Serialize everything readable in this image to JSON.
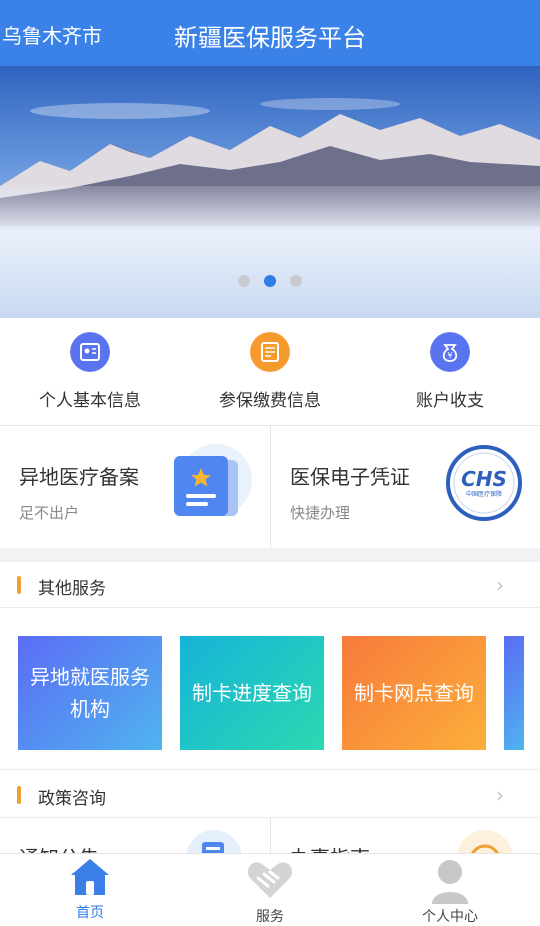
{
  "header": {
    "city": "乌鲁木齐市",
    "title": "新疆医保服务平台"
  },
  "banner": {
    "slide_count": 3,
    "active_slide": 2
  },
  "quick_actions": [
    {
      "label": "个人基本信息",
      "icon": "id-card-icon",
      "color": "#5a74f0"
    },
    {
      "label": "参保缴费信息",
      "icon": "payment-record-icon",
      "color": "#f59a2c"
    },
    {
      "label": "账户收支",
      "icon": "money-bag-icon",
      "color": "#5a74f0"
    }
  ],
  "cards": [
    {
      "title": "异地医疗备案",
      "subtitle": "足不出户",
      "icon": "star-document-icon"
    },
    {
      "title": "医保电子凭证",
      "subtitle": "快捷办理",
      "icon": "chs-logo-icon",
      "logo_text": "CHS",
      "logo_subtext": "中国医疗保障"
    }
  ],
  "sections": {
    "other_services": {
      "title": "其他服务",
      "arrow": "›"
    },
    "policy": {
      "title": "政策咨询",
      "arrow": "›"
    }
  },
  "service_tiles": [
    {
      "label": "异地就医服务机构"
    },
    {
      "label": "制卡进度查询"
    },
    {
      "label": "制卡网点查询"
    }
  ],
  "policy_cards": [
    {
      "title": "通知公告",
      "icon": "notice-icon"
    },
    {
      "title": "办事指南",
      "icon": "guide-icon"
    }
  ],
  "tabbar": [
    {
      "label": "首页",
      "icon": "home-icon",
      "active": true
    },
    {
      "label": "服务",
      "icon": "handshake-icon",
      "active": false
    },
    {
      "label": "个人中心",
      "icon": "user-icon",
      "active": false
    }
  ],
  "colors": {
    "primary": "#3b82e8",
    "accent": "#f0a030"
  }
}
